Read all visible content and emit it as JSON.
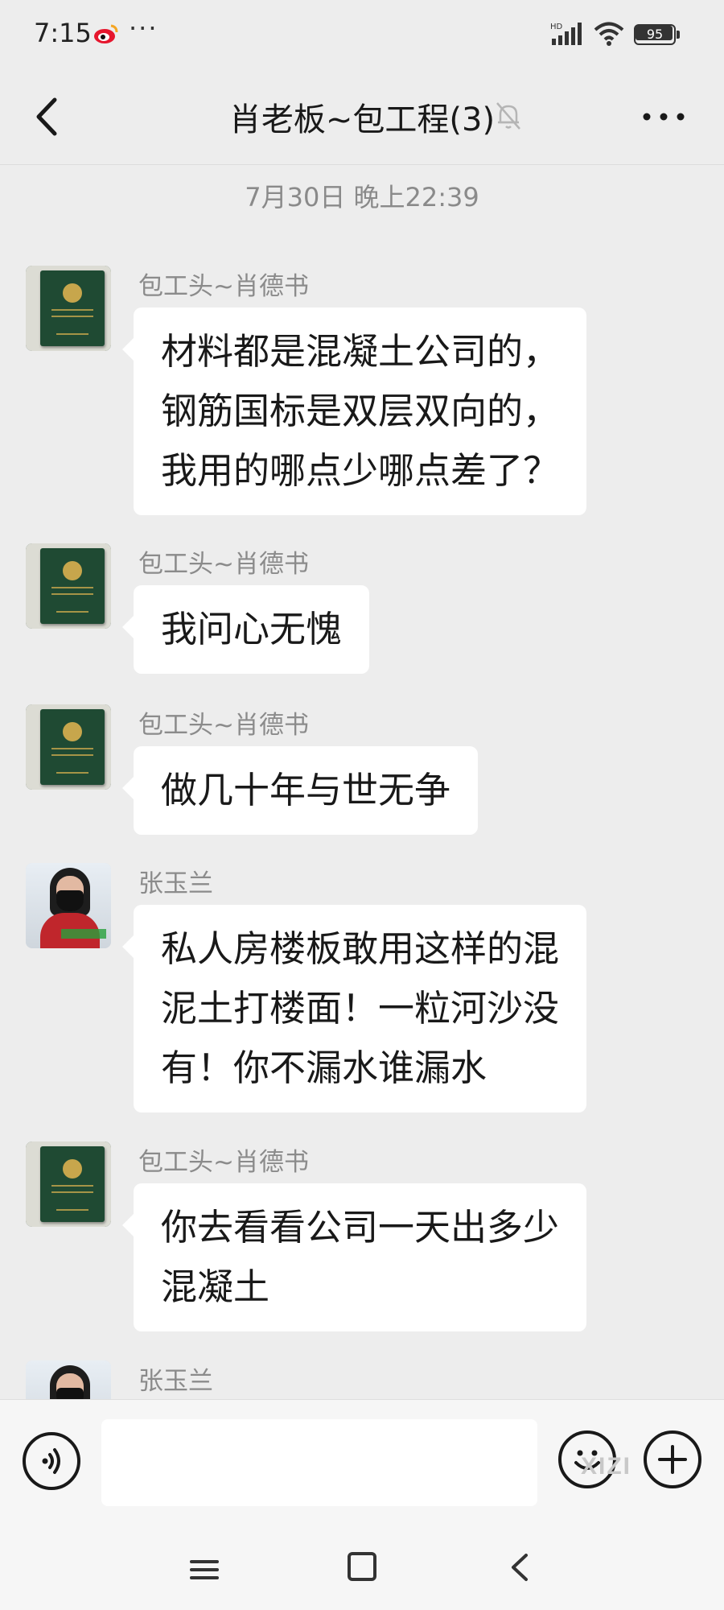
{
  "status_bar": {
    "time": "7:15",
    "more": "···",
    "network": "HD",
    "battery": "95",
    "battery_level": 0.95
  },
  "nav": {
    "title": "肖老板~包工程(3)"
  },
  "chat": {
    "timestamp": "7月30日 晚上22:39",
    "messages": [
      {
        "sender": "包工头~肖德书",
        "lines": [
          "材料都是混凝土公司的，",
          "钢筋国标是双层双向的，",
          "我用的哪点少哪点差了？"
        ]
      },
      {
        "sender": "包工头~肖德书",
        "lines": [
          "我问心无愧"
        ]
      },
      {
        "sender": "包工头~肖德书",
        "lines": [
          "做几十年与世无争"
        ]
      },
      {
        "sender": "张玉兰",
        "lines": [
          "私人房楼板敢用这样的混",
          "泥土打楼面！一粒河沙没",
          "有！你不漏水谁漏水"
        ]
      },
      {
        "sender": "包工头~肖德书",
        "lines": [
          "你去看看公司一天出多少",
          "混凝土"
        ]
      },
      {
        "sender": "张玉兰",
        "lines": []
      }
    ]
  },
  "input_bar": {
    "message_value": "",
    "watermark": "XIZI"
  },
  "icons": {
    "back": "chevron-left-icon",
    "mute": "bell-off-icon",
    "more": "more-horizontal-icon",
    "voice": "voice-icon",
    "emoji": "smile-icon",
    "add": "plus-circle-icon"
  },
  "colors": {
    "background": "#ededed",
    "bubble": "#ffffff",
    "text": "#191919",
    "sender": "#8b8b8b"
  }
}
